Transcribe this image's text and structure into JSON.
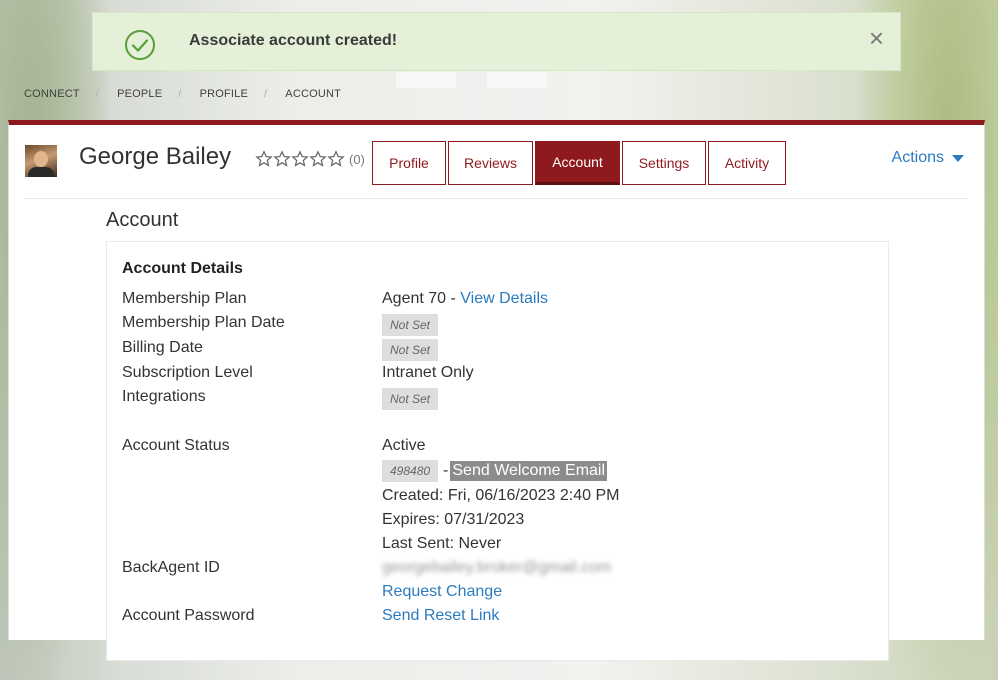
{
  "alert": {
    "message": "Associate account created!",
    "close_glyph": "×",
    "icon": "check-circle-icon"
  },
  "breadcrumb": [
    {
      "label": "CONNECT"
    },
    {
      "label": "PEOPLE"
    },
    {
      "label": "PROFILE"
    },
    {
      "label": "ACCOUNT"
    }
  ],
  "breadcrumb_sep": "/",
  "profile": {
    "name": "George Bailey",
    "rating_count": "(0)",
    "stars": 0,
    "stars_max": 5
  },
  "tabs": [
    {
      "label": "Profile"
    },
    {
      "label": "Reviews"
    },
    {
      "label": "Account",
      "active": true
    },
    {
      "label": "Settings"
    },
    {
      "label": "Activity"
    }
  ],
  "actions_label": "Actions",
  "section_title": "Account",
  "account": {
    "title": "Account Details",
    "labels": {
      "membership_plan": "Membership Plan",
      "membership_plan_date": "Membership Plan Date",
      "billing_date": "Billing Date",
      "subscription_level": "Subscription Level",
      "integrations": "Integrations",
      "account_status": "Account Status",
      "backagent_id": "BackAgent ID",
      "account_password": "Account Password"
    },
    "values": {
      "membership_plan": "Agent 70 -",
      "view_details": "View Details",
      "not_set": "Not Set",
      "subscription_level": "Intranet Only",
      "status": "Active",
      "account_id": "498480",
      "dash": "-",
      "send_welcome": "Send Welcome Email",
      "created": "Created: Fri, 06/16/2023 2:40 PM",
      "expires": "Expires: 07/31/2023",
      "last_sent": "Last Sent: Never",
      "email": "georgebailey.broker@gmail.com",
      "request_change": "Request Change",
      "send_reset": "Send Reset Link"
    }
  },
  "colors": {
    "brand": "#8f1a1e",
    "link": "#2c7bbf",
    "alert_bg": "#e4f0d7",
    "success": "#5a9e3a"
  }
}
